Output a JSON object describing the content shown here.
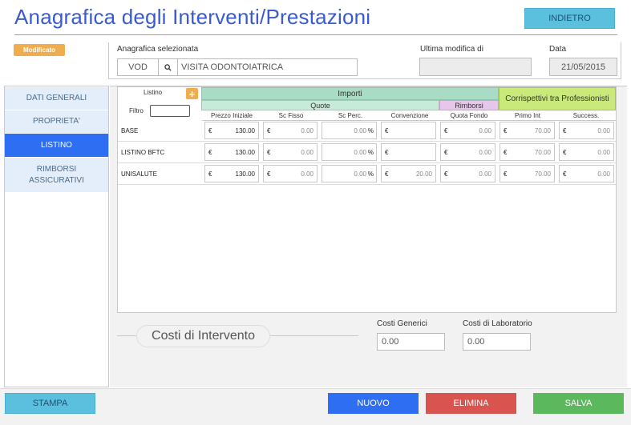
{
  "page": {
    "title": "Anagrafica degli Interventi/Prestazioni",
    "back_label": "INDIETRO",
    "badge": "Modificato"
  },
  "header": {
    "selected_label": "Anagrafica selezionata",
    "code": "VOD",
    "description": "VISITA ODONTOIATRICA",
    "last_mod_label": "Ultima modifica di",
    "last_mod_value": "",
    "date_label": "Data",
    "date_value": "21/05/2015"
  },
  "nav": {
    "items": [
      {
        "label": "DATI GENERALI",
        "active": false
      },
      {
        "label": "PROPRIETA'",
        "active": false
      },
      {
        "label": "LISTINO",
        "active": true
      },
      {
        "label": "RIMBORSI ASSICURATIVI",
        "active": false
      }
    ]
  },
  "grid": {
    "listino_label": "Listino",
    "filtro_label": "Filtro",
    "filtro_value": "",
    "importi": "Importi",
    "quote": "Quote",
    "rimborsi": "Rimborsi",
    "corrispettivi": "Corrispettivi tra Professionisti",
    "columns": [
      "Prezzo Iniziale",
      "Sc Fisso",
      "Sc Perc.",
      "Convenzione",
      "Quota Fondo",
      "Primo Int",
      "Success."
    ],
    "currency": "€",
    "percent": "%",
    "rows": [
      {
        "name": "BASE",
        "prezzo": "130.00",
        "sc_fisso": "0.00",
        "sc_perc": "0.00",
        "convenzione": "",
        "quota_fondo": "0.00",
        "primo_int": "70.00",
        "success": "0.00"
      },
      {
        "name": "LISTINO BFTC",
        "prezzo": "130.00",
        "sc_fisso": "0.00",
        "sc_perc": "0.00",
        "convenzione": "",
        "quota_fondo": "0.00",
        "primo_int": "70.00",
        "success": "0.00"
      },
      {
        "name": "UNISALUTE",
        "prezzo": "130.00",
        "sc_fisso": "0.00",
        "sc_perc": "0.00",
        "convenzione": "20.00",
        "quota_fondo": "0.00",
        "primo_int": "70.00",
        "success": "0.00"
      }
    ]
  },
  "costs": {
    "section_title": "Costi di Intervento",
    "generici_label": "Costi Generici",
    "generici_value": "0.00",
    "laboratorio_label": "Costi di Laboratorio",
    "laboratorio_value": "0.00"
  },
  "footer": {
    "stampa": "STAMPA",
    "nuovo": "NUOVO",
    "elimina": "ELIMINA",
    "salva": "SALVA"
  },
  "colors": {
    "title": "#3a5bd0",
    "nav_active": "#2d6ef2",
    "nuovo": "#2d6ef2",
    "elimina": "#d9534f",
    "salva": "#5cb85c",
    "stampa": "#5bc0de"
  }
}
